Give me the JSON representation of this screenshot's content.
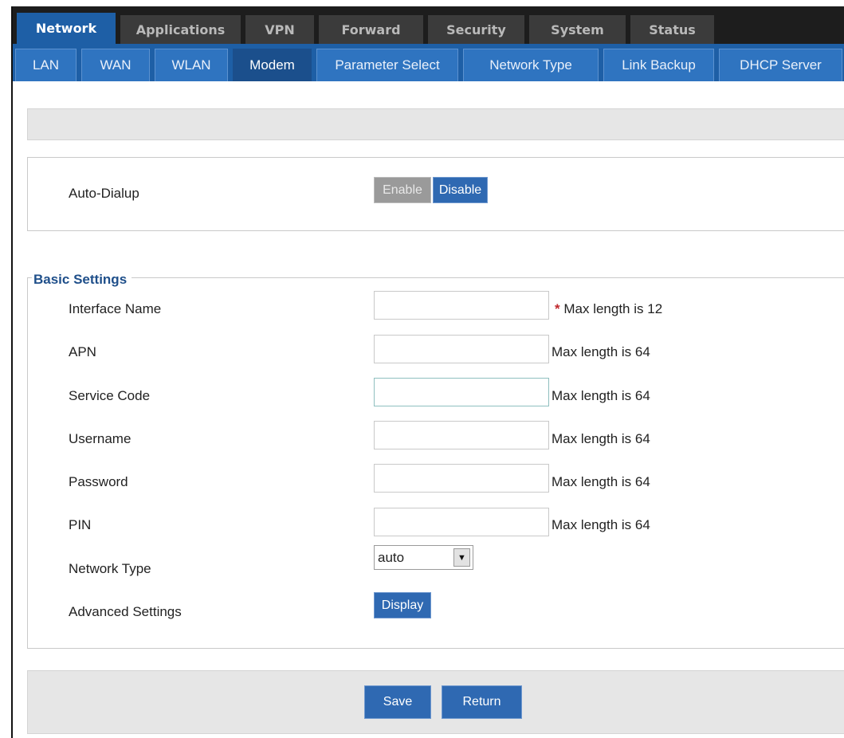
{
  "nav": {
    "top_tabs": [
      "Network",
      "Applications",
      "VPN",
      "Forward",
      "Security",
      "System",
      "Status"
    ],
    "sub_tabs": [
      "LAN",
      "WAN",
      "WLAN",
      "Modem",
      "Parameter Select",
      "Network Type",
      "Link Backup",
      "DHCP Server"
    ]
  },
  "auto_dialup": {
    "label": "Auto-Dialup",
    "enable_label": "Enable",
    "disable_label": "Disable",
    "selected": "Disable"
  },
  "basic_settings": {
    "legend": "Basic Settings",
    "fields": [
      {
        "label": "Interface Name",
        "value": "",
        "required_mark": "*",
        "hint": "Max length is 12"
      },
      {
        "label": "APN",
        "value": "",
        "hint": "Max length is 64"
      },
      {
        "label": "Service Code",
        "value": "",
        "hint": "Max length is 64"
      },
      {
        "label": "Username",
        "value": "",
        "hint": "Max length is 64"
      },
      {
        "label": "Password",
        "value": "",
        "hint": "Max length is 64"
      },
      {
        "label": "PIN",
        "value": "",
        "hint": "Max length is 64"
      }
    ],
    "network_type": {
      "label": "Network Type",
      "value": "auto",
      "arrow_icon": "chevron-down-icon"
    },
    "advanced": {
      "label": "Advanced Settings",
      "button_label": "Display"
    }
  },
  "footer": {
    "save_label": "Save",
    "return_label": "Return"
  },
  "colors": {
    "nav_blue": "#1e5fa6",
    "button_blue": "#2f69b2",
    "legend_blue": "#1f4f8a",
    "required_red": "#c0282d"
  }
}
